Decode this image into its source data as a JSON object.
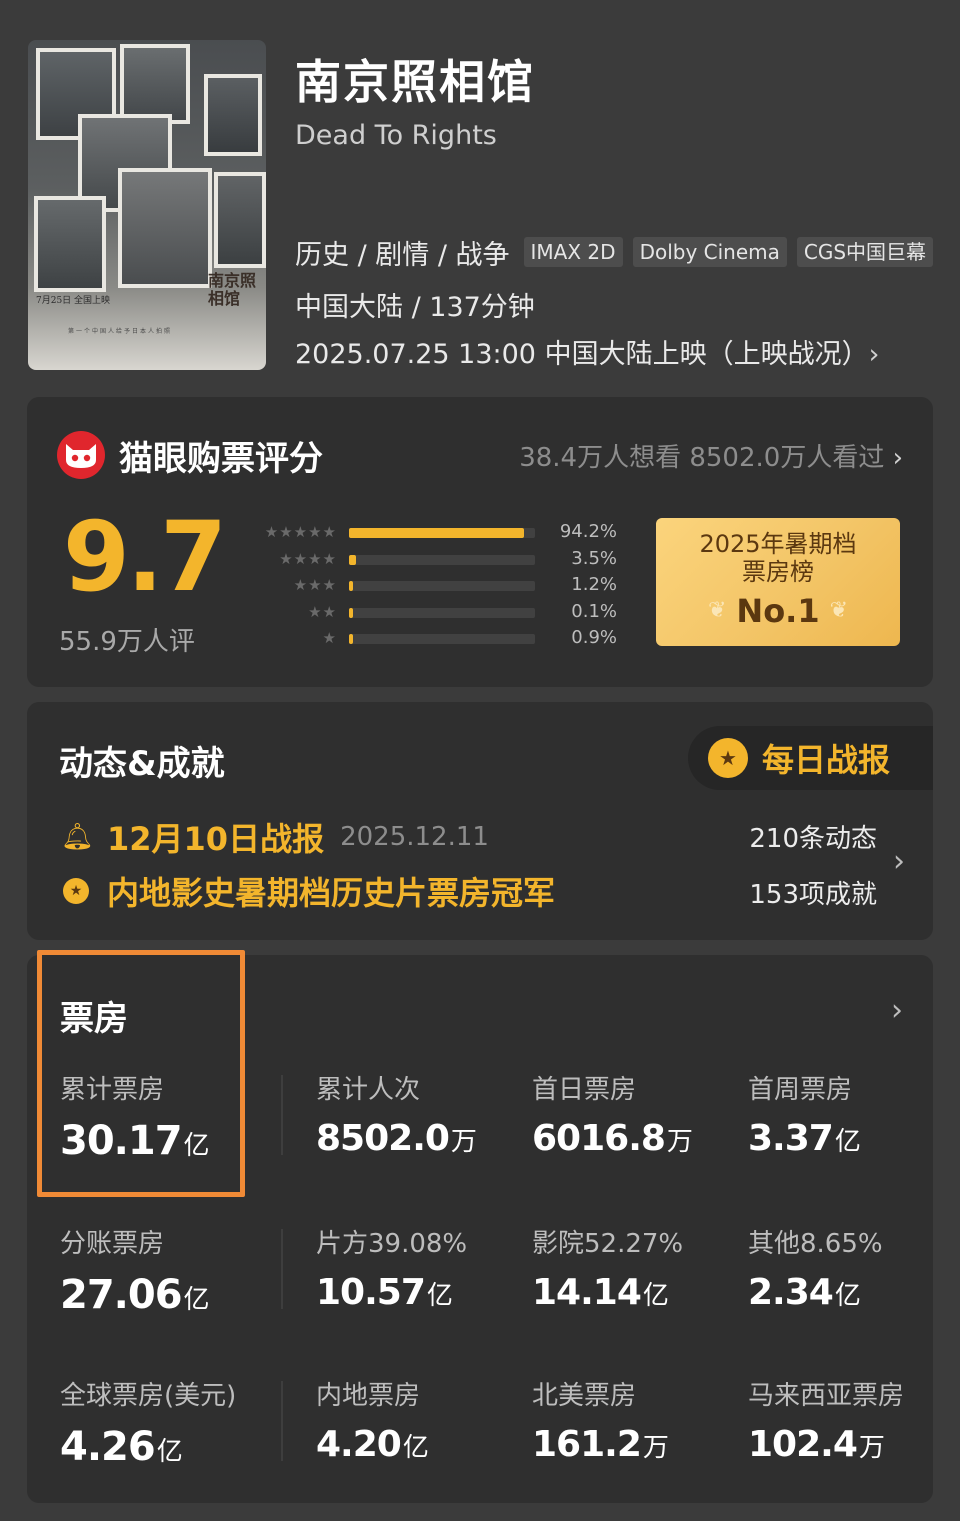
{
  "movie": {
    "title_cn": "南京照相馆",
    "title_en": "Dead To Rights",
    "genres": "历史 / 剧情 / 战争",
    "formats": [
      "IMAX 2D",
      "Dolby Cinema",
      "CGS中国巨幕"
    ],
    "region_duration": "中国大陆 / 137分钟",
    "release": "2025.07.25 13:00 中国大陆上映（上映战况）",
    "poster": {
      "title": "南京照相馆",
      "date": "7月25日 全国上映",
      "tagline": "第一个中国人给予日本人拍照"
    }
  },
  "rating": {
    "title": "猫眼购票评分",
    "stats": "38.4万人想看 8502.0万人看过",
    "score": "9.7",
    "votes": "55.9万人评",
    "distribution": [
      {
        "stars": "★★★★★",
        "pct": "94.2%",
        "value": 94.2
      },
      {
        "stars": "★★★★",
        "pct": "3.5%",
        "value": 3.5
      },
      {
        "stars": "★★★",
        "pct": "1.2%",
        "value": 1.2
      },
      {
        "stars": "★★",
        "pct": "0.1%",
        "value": 0.1
      },
      {
        "stars": "★",
        "pct": "0.9%",
        "value": 0.9
      }
    ],
    "rank": {
      "line1": "2025年暑期档",
      "line2": "票房榜",
      "line3": "No.1"
    }
  },
  "news": {
    "title": "动态&成就",
    "daily_button": "每日战报",
    "item1": {
      "text": "12月10日战报",
      "date": "2025.12.11"
    },
    "item2": {
      "text": "内地影史暑期档历史片票房冠军"
    },
    "count1": "210条动态",
    "count2": "153项成就"
  },
  "box_office": {
    "title": "票房",
    "row1": [
      {
        "label": "累计票房",
        "value": "30.17",
        "unit": "亿"
      },
      {
        "label": "累计人次",
        "value": "8502.0",
        "unit": "万"
      },
      {
        "label": "首日票房",
        "value": "6016.8",
        "unit": "万"
      },
      {
        "label": "首周票房",
        "value": "3.37",
        "unit": "亿"
      }
    ],
    "row2": [
      {
        "label": "分账票房",
        "value": "27.06",
        "unit": "亿"
      },
      {
        "label": "片方39.08%",
        "value": "10.57",
        "unit": "亿"
      },
      {
        "label": "影院52.27%",
        "value": "14.14",
        "unit": "亿"
      },
      {
        "label": "其他8.65%",
        "value": "2.34",
        "unit": "亿"
      }
    ],
    "row3": [
      {
        "label": "全球票房(美元)",
        "value": "4.26",
        "unit": "亿"
      },
      {
        "label": "内地票房",
        "value": "4.20",
        "unit": "亿"
      },
      {
        "label": "北美票房",
        "value": "161.2",
        "unit": "万"
      },
      {
        "label": "马来西亚票房",
        "value": "102.4",
        "unit": "万"
      }
    ]
  },
  "colors": {
    "accent": "#f3b52c",
    "highlight": "#f08a36",
    "brand_red": "#e0262d"
  },
  "icons": [
    "chevron-right-icon",
    "maoyan-logo-icon",
    "medal-icon",
    "bell-icon",
    "star-icon",
    "wheat-icon"
  ]
}
